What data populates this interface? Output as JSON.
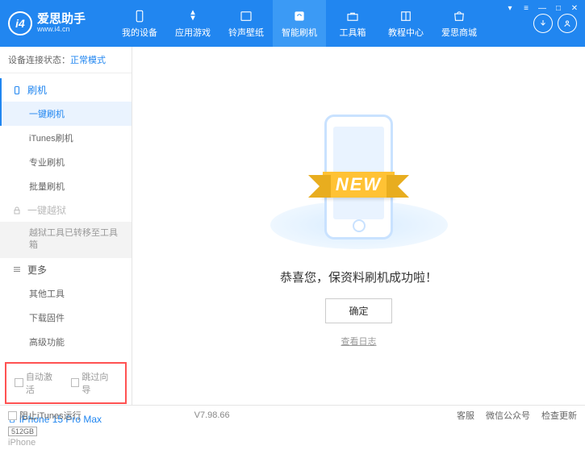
{
  "header": {
    "logo_text": "爱思助手",
    "logo_sub": "www.i4.cn",
    "nav": [
      {
        "label": "我的设备"
      },
      {
        "label": "应用游戏"
      },
      {
        "label": "铃声壁纸"
      },
      {
        "label": "智能刷机"
      },
      {
        "label": "工具箱"
      },
      {
        "label": "教程中心"
      },
      {
        "label": "爱思商城"
      }
    ]
  },
  "sidebar": {
    "status_label": "设备连接状态：",
    "status_value": "正常模式",
    "sections": {
      "flash": {
        "title": "刷机",
        "items": [
          "一键刷机",
          "iTunes刷机",
          "专业刷机",
          "批量刷机"
        ]
      },
      "jailbreak": {
        "title": "一键越狱",
        "note": "越狱工具已转移至工具箱"
      },
      "more": {
        "title": "更多",
        "items": [
          "其他工具",
          "下载固件",
          "高级功能"
        ]
      }
    },
    "checkboxes": {
      "auto_activate": "自动激活",
      "skip_guide": "跳过向导"
    },
    "device": {
      "name": "iPhone 15 Pro Max",
      "storage": "512GB",
      "type": "iPhone"
    }
  },
  "main": {
    "ribbon": "NEW",
    "message": "恭喜您，保资料刷机成功啦！",
    "ok": "确定",
    "view_log": "查看日志"
  },
  "footer": {
    "block_itunes": "阻止iTunes运行",
    "version": "V7.98.66",
    "links": [
      "客服",
      "微信公众号",
      "检查更新"
    ]
  }
}
